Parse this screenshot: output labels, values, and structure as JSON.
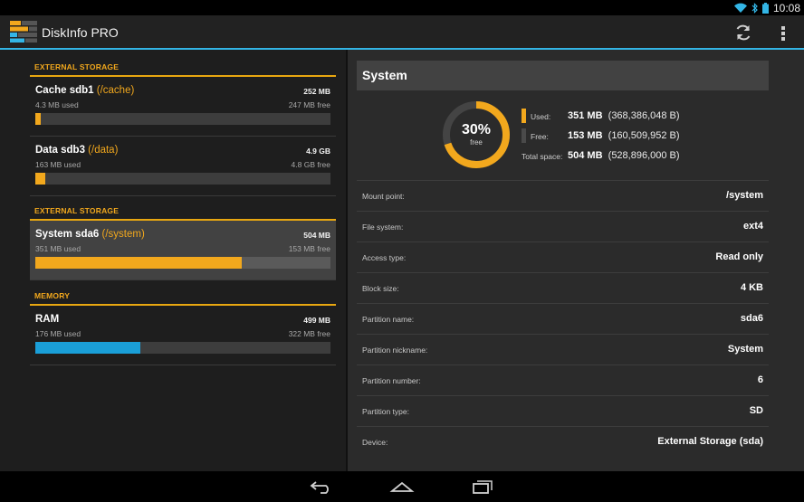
{
  "status": {
    "time": "10:08"
  },
  "app": {
    "title": "DiskInfo PRO"
  },
  "colors": {
    "accent": "#33b5e5",
    "orange": "#f2a81d",
    "blue": "#1a9fd8"
  },
  "storage_groups": [
    {
      "header": "EXTERNAL STORAGE",
      "items": [
        {
          "name": "Cache sdb1",
          "path": "(/cache)",
          "total": "252 MB",
          "used": "4.3 MB used",
          "free": "247 MB free",
          "fill": 0.017
        },
        {
          "name": "Data sdb3",
          "path": "(/data)",
          "total": "4.9 GB",
          "used": "163 MB used",
          "free": "4.8 GB free",
          "fill": 0.033
        }
      ]
    },
    {
      "header": "EXTERNAL STORAGE",
      "items": [
        {
          "name": "System sda6",
          "path": "(/system)",
          "total": "504 MB",
          "used": "351 MB used",
          "free": "153 MB free",
          "fill": 0.7
        }
      ]
    },
    {
      "header": "MEMORY",
      "items": [
        {
          "name": "RAM",
          "path": "",
          "total": "499 MB",
          "used": "176 MB used",
          "free": "322 MB free",
          "fill": 0.355
        }
      ]
    }
  ],
  "detail": {
    "title": "System",
    "donut": {
      "percent": "30%",
      "label": "free",
      "free_fraction": 0.3
    },
    "legend": {
      "used_label": "Used:",
      "used_value": "351 MB",
      "used_bytes": "(368,386,048 B)",
      "free_label": "Free:",
      "free_value": "153 MB",
      "free_bytes": "(160,509,952 B)",
      "total_label": "Total space:",
      "total_value": "504 MB",
      "total_bytes": "(528,896,000 B)"
    },
    "properties": [
      {
        "key": "Mount point:",
        "value": "/system"
      },
      {
        "key": "File system:",
        "value": "ext4"
      },
      {
        "key": "Access type:",
        "value": "Read only"
      },
      {
        "key": "Block size:",
        "value": "4 KB"
      },
      {
        "key": "Partition name:",
        "value": "sda6"
      },
      {
        "key": "Partition nickname:",
        "value": "System"
      },
      {
        "key": "Partition number:",
        "value": "6"
      },
      {
        "key": "Partition type:",
        "value": "SD"
      },
      {
        "key": "Device:",
        "value": "External Storage (sda)"
      }
    ]
  }
}
